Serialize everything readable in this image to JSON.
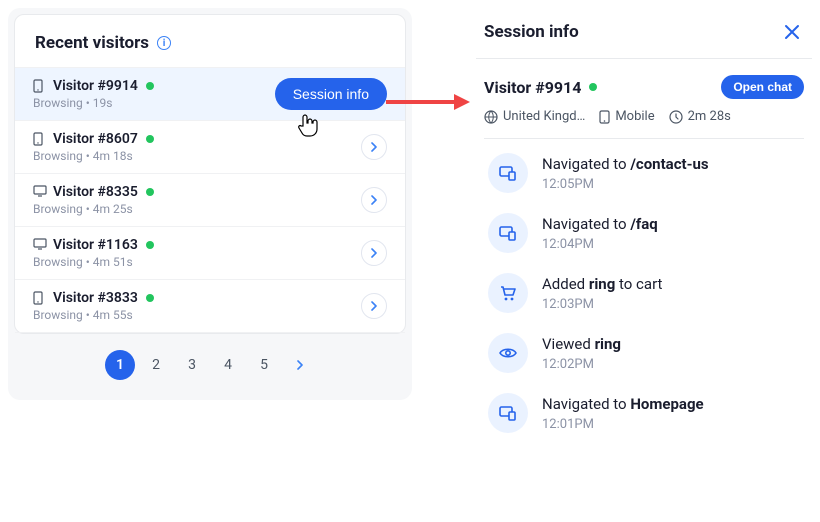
{
  "left": {
    "title": "Recent visitors",
    "visitors": [
      {
        "name": "Visitor #9914",
        "device": "mobile",
        "status_prefix": "Browsing",
        "duration": "19s",
        "selected": true
      },
      {
        "name": "Visitor #8607",
        "device": "mobile",
        "status_prefix": "Browsing",
        "duration": "4m 18s",
        "selected": false
      },
      {
        "name": "Visitor #8335",
        "device": "desktop",
        "status_prefix": "Browsing",
        "duration": "4m 25s",
        "selected": false
      },
      {
        "name": "Visitor #1163",
        "device": "desktop",
        "status_prefix": "Browsing",
        "duration": "4m 51s",
        "selected": false
      },
      {
        "name": "Visitor #3833",
        "device": "mobile",
        "status_prefix": "Browsing",
        "duration": "4m 55s",
        "selected": false
      }
    ],
    "session_button": "Session info",
    "pages": [
      "1",
      "2",
      "3",
      "4",
      "5"
    ],
    "active_page": 0
  },
  "right": {
    "title": "Session info",
    "visitor_name": "Visitor #9914",
    "open_chat": "Open chat",
    "meta": {
      "country": "United Kingd…",
      "device": "Mobile",
      "duration": "2m 28s"
    },
    "timeline": [
      {
        "icon": "nav",
        "text_pre": "Navigated to ",
        "text_bold": "/contact-us",
        "text_post": "",
        "time": "12:05PM"
      },
      {
        "icon": "nav",
        "text_pre": "Navigated to ",
        "text_bold": "/faq",
        "text_post": "",
        "time": "12:04PM"
      },
      {
        "icon": "cart",
        "text_pre": "Added ",
        "text_bold": "ring",
        "text_post": " to cart",
        "time": "12:03PM"
      },
      {
        "icon": "eye",
        "text_pre": "Viewed ",
        "text_bold": "ring",
        "text_post": "",
        "time": "12:02PM"
      },
      {
        "icon": "nav",
        "text_pre": "Navigated to ",
        "text_bold": "Homepage",
        "text_post": "",
        "time": "12:01PM"
      }
    ]
  },
  "colors": {
    "primary": "#2563eb",
    "online": "#22c55e",
    "arrow": "#ef4444"
  }
}
